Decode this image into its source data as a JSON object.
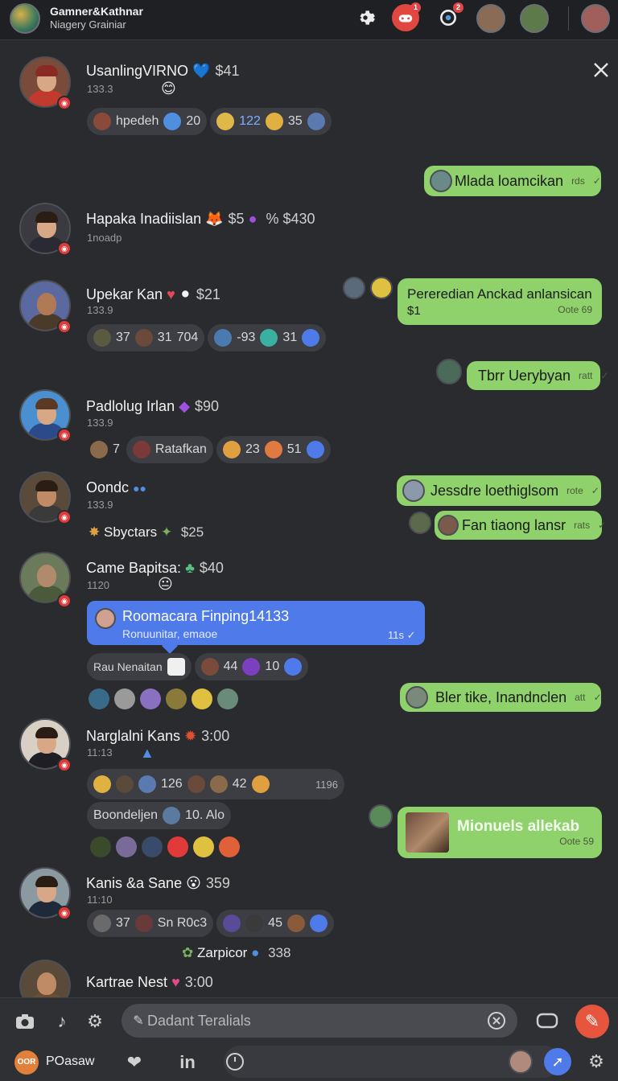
{
  "header": {
    "title": "Gamner&Kathnar",
    "subtitle": "Niagery Grainiar",
    "badges": {
      "b1": "1",
      "b2": "2"
    }
  },
  "feed": [
    {
      "name": "UsanlingVIRNO",
      "amount": "$41",
      "time": "133.3",
      "reactions": [
        "hpedeh",
        "20",
        "122",
        "35"
      ]
    },
    {
      "name": "Hapaka Inadiislan",
      "amount": "$5",
      "extra": "% $430",
      "time": "1noadp"
    },
    {
      "name": "Upekar Kan",
      "amount": "$21",
      "time": "133.9",
      "reactions": [
        "37",
        "31",
        "704",
        "-93",
        "31"
      ]
    },
    {
      "name": "Padlolug Irlan",
      "amount": "$90",
      "time": "133.9",
      "reactions": [
        "7",
        "Ratafkan",
        "23",
        "51"
      ]
    },
    {
      "name": "Oondc",
      "time": "133.9",
      "sub_name": "Sbyctars",
      "sub_amount": "$25"
    },
    {
      "name": "Came Bapitsa:",
      "amount": "$40",
      "time": "1120",
      "card_title": "Roomacara Finping14133",
      "card_sub": "Ronuunitar, emaoe",
      "card_time": "11s",
      "reactions": [
        "Rau Nenaitan",
        "44",
        "10"
      ]
    },
    {
      "name": "Narglalni Kans",
      "amount": "3:00",
      "time": "11:13",
      "reactions": [
        "126",
        "42",
        "1196"
      ],
      "tag": "Boondeljen",
      "tag_count": "10. Alo"
    },
    {
      "name": "Kanis &a Sane",
      "amount": "359",
      "time": "11:10",
      "reactions": [
        "37",
        "Sn R0c3",
        "45"
      ],
      "sub_name": "Zarpicor",
      "sub_amount": "338"
    },
    {
      "name": "Kartrae Nest",
      "amount": "3:00"
    }
  ],
  "bubbles": [
    {
      "text": "Mlada loamcikan",
      "time": "rds"
    },
    {
      "text": "Pereredian Anckad anlansican",
      "line2": "$1",
      "time": "Oote 69"
    },
    {
      "text": "Tbrr Uerybyan",
      "time": "ratt"
    },
    {
      "text": "Jessdre loethiglsom",
      "time": "rote"
    },
    {
      "text": "Fan tiaong lansr",
      "time": "rats"
    },
    {
      "text": "Bler tike, Inandnclen",
      "time": "att"
    },
    {
      "text": "Mionuels allekab",
      "time": "Oote 59"
    }
  ],
  "composer": {
    "placeholder": "Dadant Teralials",
    "user_label": "POasaw",
    "user_initials": "OOR"
  },
  "colors": {
    "bubble_green": "#8fd16a",
    "card_blue": "#4f7bea",
    "send_red": "#e8553e",
    "badge_red": "#e03a3a"
  }
}
